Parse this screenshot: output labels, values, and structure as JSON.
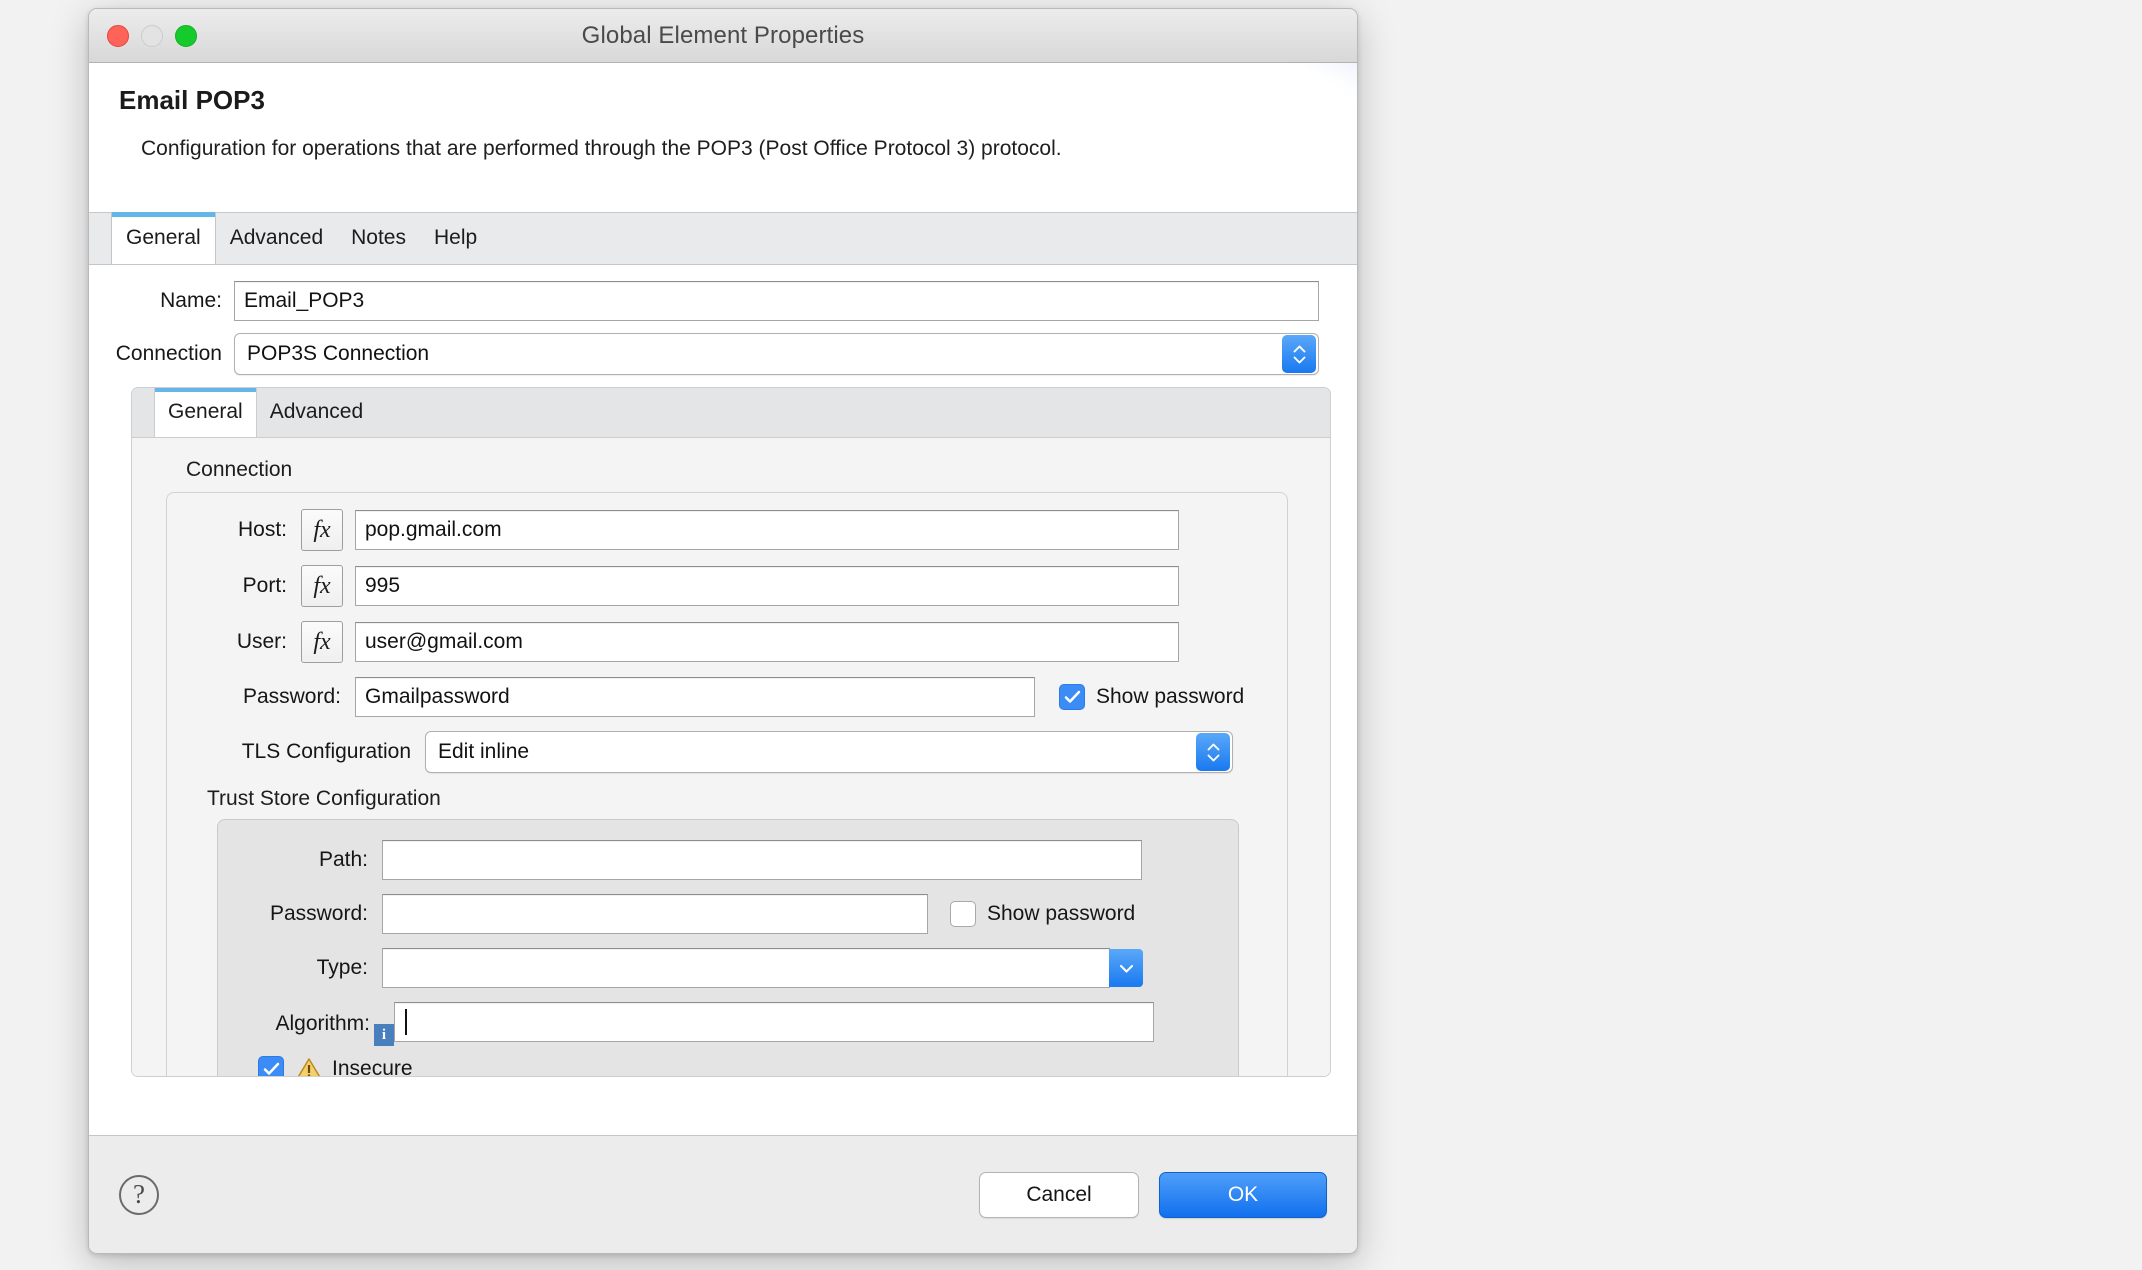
{
  "window": {
    "title": "Global Element Properties",
    "traffic_lights": [
      "close-red",
      "minimize-disabled",
      "zoom-green"
    ]
  },
  "header": {
    "title": "Email POP3",
    "description": "Configuration for operations that are performed through the POP3 (Post Office Protocol 3) protocol."
  },
  "outer_tabs": [
    {
      "label": "General",
      "active": true
    },
    {
      "label": "Advanced",
      "active": false
    },
    {
      "label": "Notes",
      "active": false
    },
    {
      "label": "Help",
      "active": false
    }
  ],
  "fields": {
    "name_label": "Name:",
    "name_value": "Email_POP3",
    "connection_label": "Connection",
    "connection_value": "POP3S Connection"
  },
  "inner_tabs": [
    {
      "label": "General",
      "active": true
    },
    {
      "label": "Advanced",
      "active": false
    }
  ],
  "connection_group": {
    "title": "Connection",
    "host_label": "Host:",
    "host_value": "pop.gmail.com",
    "host_fx": "fx",
    "port_label": "Port:",
    "port_value": "995",
    "port_fx": "fx",
    "user_label": "User:",
    "user_value": "user@gmail.com",
    "user_fx": "fx",
    "password_label": "Password:",
    "password_value": "Gmailpassword",
    "show_password_label": "Show password",
    "show_password_checked": true,
    "tls_label": "TLS Configuration",
    "tls_value": "Edit inline"
  },
  "trust_store": {
    "title": "Trust Store Configuration",
    "path_label": "Path:",
    "path_value": "",
    "password_label": "Password:",
    "password_value": "",
    "show_password_label": "Show password",
    "show_password_checked": false,
    "type_label": "Type:",
    "type_value": "",
    "algorithm_label": "Algorithm:",
    "algorithm_value": "",
    "algorithm_info_badge": "i",
    "insecure_label": "Insecure",
    "insecure_checked": true,
    "insecure_warning_icon": "warning-triangle"
  },
  "footer": {
    "help_glyph": "?",
    "cancel_label": "Cancel",
    "ok_label": "OK"
  },
  "colors": {
    "accent_blue": "#1a79f0",
    "tab_indicator": "#64b5e8",
    "checkbox_on": "#3b8cf6",
    "warning": "#f0c040"
  }
}
